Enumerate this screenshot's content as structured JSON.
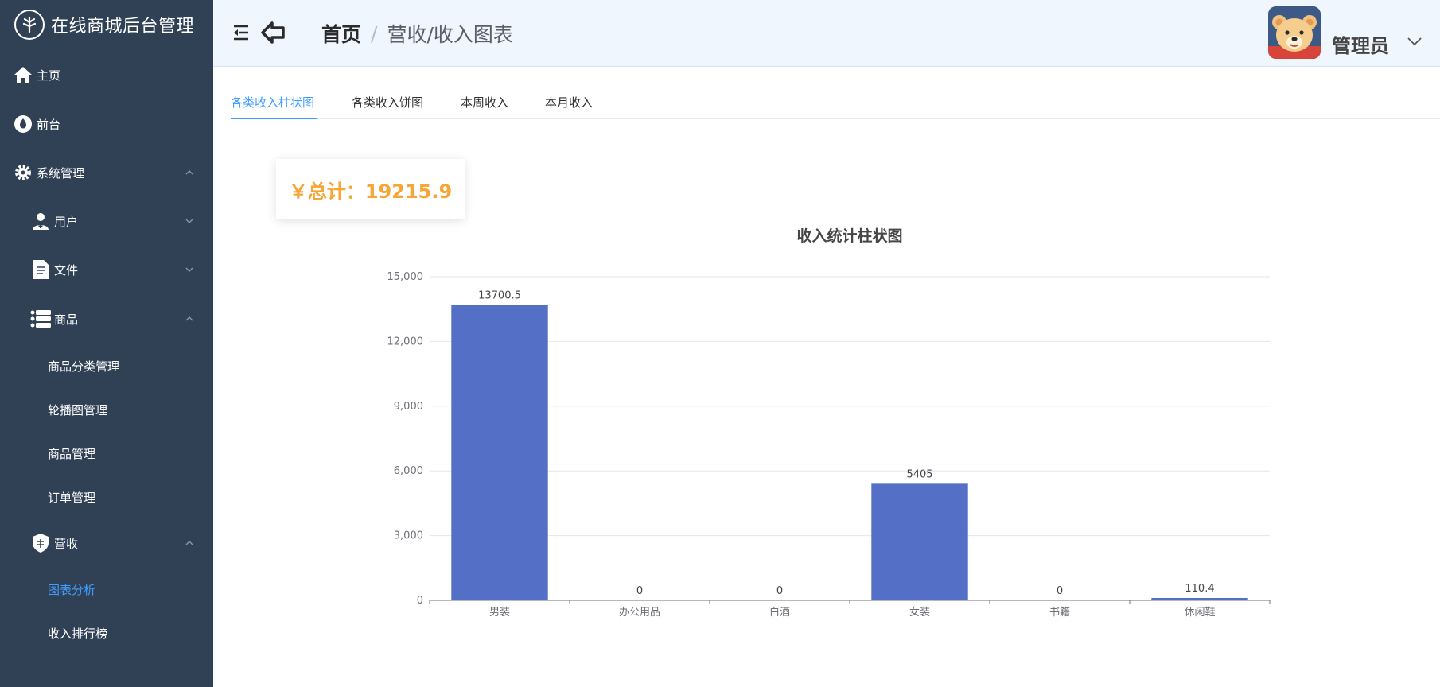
{
  "app": {
    "title": "在线商城后台管理"
  },
  "sidebar": {
    "items": [
      {
        "label": "主页",
        "icon": "home-icon"
      },
      {
        "label": "前台",
        "icon": "drop-icon"
      },
      {
        "label": "系统管理",
        "icon": "gear-icon",
        "expanded": true
      },
      {
        "label": "用户",
        "icon": "user-icon",
        "expanded": false
      },
      {
        "label": "文件",
        "icon": "file-icon",
        "expanded": false
      },
      {
        "label": "商品",
        "icon": "list-icon",
        "expanded": true
      },
      {
        "label": "商品分类管理"
      },
      {
        "label": "轮播图管理"
      },
      {
        "label": "商品管理"
      },
      {
        "label": "订单管理"
      },
      {
        "label": "营收",
        "icon": "shield-icon",
        "expanded": true
      },
      {
        "label": "图表分析",
        "active": true
      },
      {
        "label": "收入排行榜"
      }
    ]
  },
  "header": {
    "breadcrumb": {
      "home": "首页",
      "separator": "/",
      "current": "营收/收入图表"
    },
    "user": {
      "name": "管理员"
    }
  },
  "tabs": [
    {
      "label": "各类收入柱状图",
      "active": true
    },
    {
      "label": "各类收入饼图"
    },
    {
      "label": "本周收入"
    },
    {
      "label": "本月收入"
    }
  ],
  "summary": {
    "total_text": "￥总计：19215.9"
  },
  "colors": {
    "sidebar_bg": "#304156",
    "accent": "#409eff",
    "bar": "#5470c6",
    "total": "#f7a534"
  },
  "chart_data": {
    "type": "bar",
    "title": "收入统计柱状图",
    "categories": [
      "男装",
      "办公用品",
      "白酒",
      "女装",
      "书籍",
      "休闲鞋"
    ],
    "values": [
      13700.5,
      0,
      0,
      5405,
      0,
      110.4
    ],
    "value_labels": [
      "13700.5",
      "0",
      "0",
      "5405",
      "0",
      "110.4"
    ],
    "ylim": [
      0,
      15000
    ],
    "yticks": [
      0,
      3000,
      6000,
      9000,
      12000,
      15000
    ],
    "ytick_labels": [
      "0",
      "3,000",
      "6,000",
      "9,000",
      "12,000",
      "15,000"
    ],
    "grid": true,
    "xlabel": "",
    "ylabel": ""
  }
}
